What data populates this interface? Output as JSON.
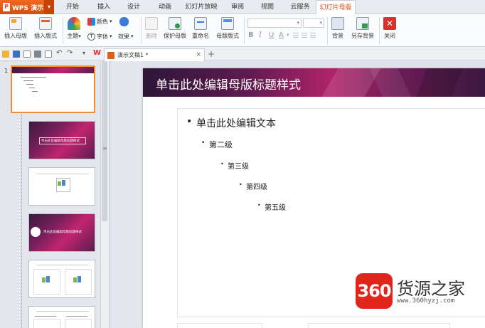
{
  "app": {
    "name": "WPS 演示",
    "logo_letter": "P"
  },
  "menu_tabs": [
    "开始",
    "插入",
    "设计",
    "动画",
    "幻灯片放映",
    "审阅",
    "视图",
    "云服务",
    "幻灯片母版"
  ],
  "active_tab": "幻灯片母版",
  "ribbon": {
    "insert_master": "插入母版",
    "insert_layout": "插入版式",
    "theme": "主题",
    "colors": "颜色",
    "fonts": "字体",
    "effects": "效果",
    "delete": "删除",
    "preserve_master": "保护母版",
    "rename": "重命名",
    "master_layout": "母版版式",
    "background": "背景",
    "save_background": "另存背景",
    "close": "关闭",
    "bold": "B",
    "italic": "I",
    "underline": "U",
    "font_color": "A"
  },
  "document_tab": {
    "title": "演示文稿1 *",
    "brand_mark": "W"
  },
  "slides_pane": {
    "current_number": "1"
  },
  "thumbnails": {
    "title_master_text": "单击此处编辑母版标题样式"
  },
  "slide": {
    "title": "单击此处编辑母版标题样式",
    "levels": [
      "单击此处编辑文本",
      "第二级",
      "第三级",
      "第四级",
      "第五级"
    ],
    "bullet": "•"
  },
  "watermark": {
    "badge": "360",
    "name": "货源之家",
    "url": "www.360hyzj.com"
  },
  "colors": {
    "accent": "#e0530f",
    "title_bar": "#b0236a",
    "selected_border": "#f08a3c"
  }
}
